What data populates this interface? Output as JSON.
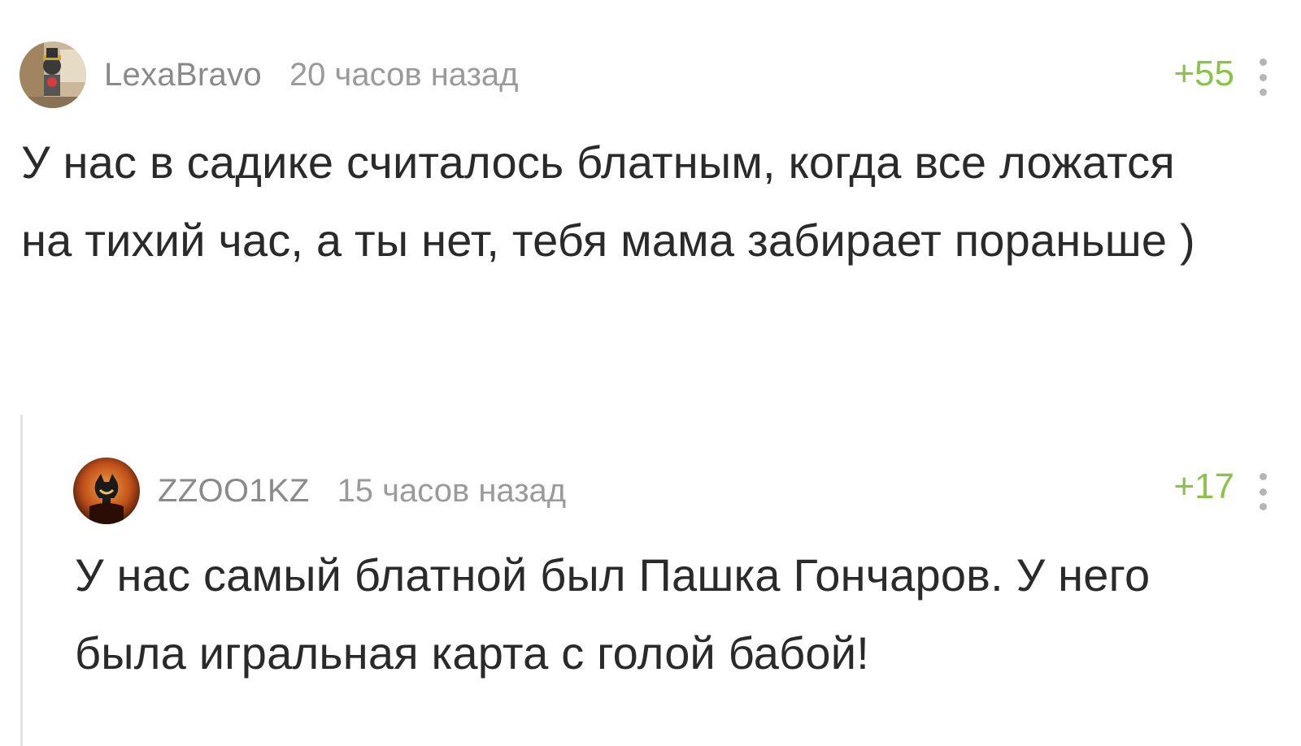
{
  "comments": [
    {
      "username": "LexaBravo",
      "time": "20 часов назад",
      "rating": "+55",
      "avatar_icon": "user-avatar-icon",
      "text": "У нас в садике считалось блатным, когда все ложатся на тихий час, а ты нет, тебя мама забирает пораньше )"
    },
    {
      "username": "ZZOO1KZ",
      "time": "15 часов назад",
      "rating": "+17",
      "avatar_icon": "user-avatar-icon",
      "text": "У нас самый блатной был Пашка Гончаров. У него была игральная карта с голой бабой!"
    }
  ],
  "colors": {
    "rating": "#8bc34a",
    "username": "#8a8a8a",
    "time": "#9a9a9a",
    "text": "#2a2a2a",
    "thread_line": "#e3e3e3"
  },
  "icons": {
    "menu": "more-vertical-icon"
  }
}
